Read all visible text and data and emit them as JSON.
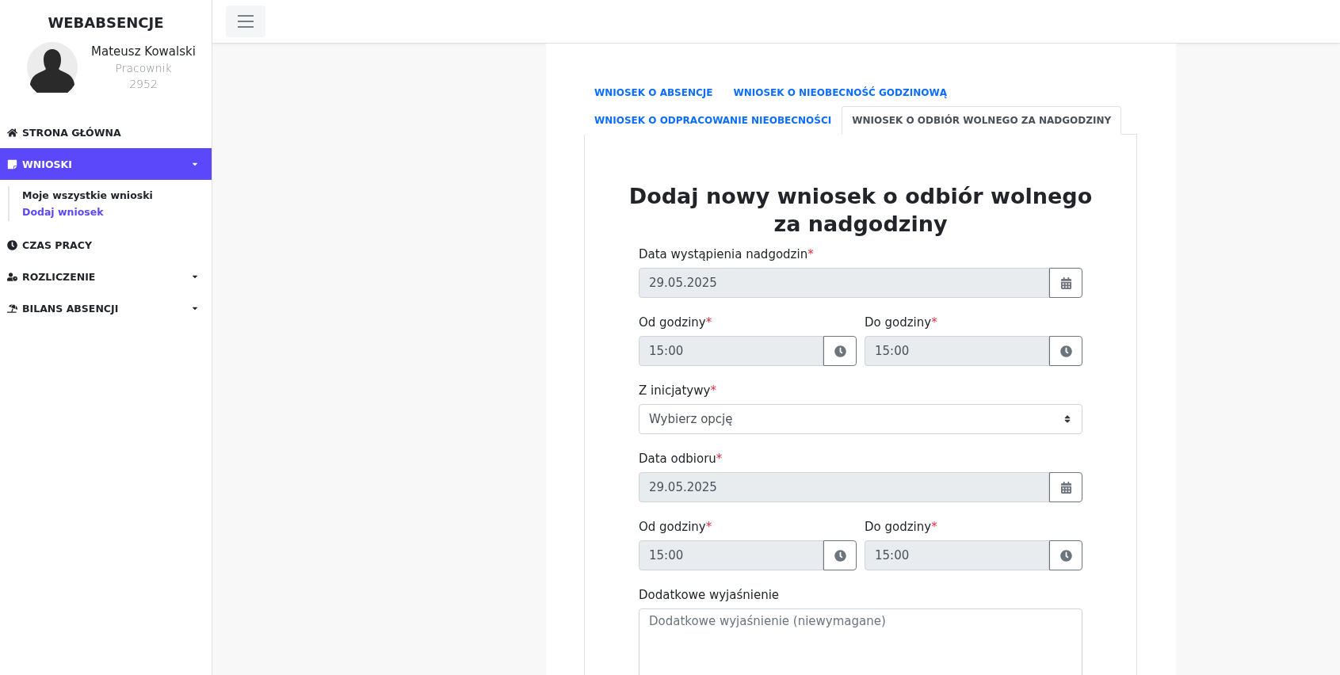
{
  "sidebar": {
    "brand": "WEBABSENCJE",
    "user": {
      "name": "Mateusz Kowalski",
      "role": "Pracownik",
      "number": "2952"
    },
    "menu": [
      {
        "label": "STRONA GŁÓWNA",
        "selected": false,
        "expandable": false
      },
      {
        "label": "WNIOSKI",
        "selected": true,
        "expandable": true,
        "expanded": true,
        "children": [
          {
            "label": "Moje wszystkie wnioski",
            "selected": false
          },
          {
            "label": "Dodaj wniosek",
            "selected": true
          }
        ]
      },
      {
        "label": "CZAS PRACY",
        "selected": false,
        "expandable": false
      },
      {
        "label": "ROZLICZENIE",
        "selected": false,
        "expandable": true
      },
      {
        "label": "BILANS ABSENCJI",
        "selected": false,
        "expandable": true
      }
    ]
  },
  "tabs": [
    {
      "label": "WNIOSEK O ABSENCJE",
      "selected": false
    },
    {
      "label": "WNIOSEK O NIEOBECNOŚĆ GODZINOWĄ",
      "selected": false
    },
    {
      "label": "WNIOSEK O ODPRACOWANIE NIEOBECNOŚCI",
      "selected": false
    },
    {
      "label": "WNIOSEK O ODBIÓR WOLNEGO ZA NADGODZINY",
      "selected": true
    }
  ],
  "form": {
    "title": "Dodaj nowy wniosek o odbiór wolnego za nadgodziny",
    "fields": [
      {
        "kind": "date",
        "label": "Data wystąpienia nadgodzin",
        "required_mark": "*",
        "value": "29.05.2025"
      },
      {
        "kind": "time_pair",
        "items": [
          {
            "label": "Od godziny",
            "required_mark": "*",
            "value": "15:00"
          },
          {
            "label": "Do godziny",
            "required_mark": "*",
            "value": "15:00"
          }
        ]
      },
      {
        "kind": "select",
        "label": "Z inicjatywy",
        "required_mark": "*",
        "value": "Wybierz opcję"
      },
      {
        "kind": "date",
        "label": "Data odbioru",
        "required_mark": "*",
        "value": "29.05.2025"
      },
      {
        "kind": "time_pair",
        "items": [
          {
            "label": "Od godziny",
            "required_mark": "*",
            "value": "15:00"
          },
          {
            "label": "Do godziny",
            "required_mark": "*",
            "value": "15:00"
          }
        ]
      },
      {
        "kind": "textarea",
        "label": "Dodatkowe wyjaśnienie",
        "placeholder": "Dodatkowe wyjaśnienie (niewymagane)"
      }
    ]
  }
}
